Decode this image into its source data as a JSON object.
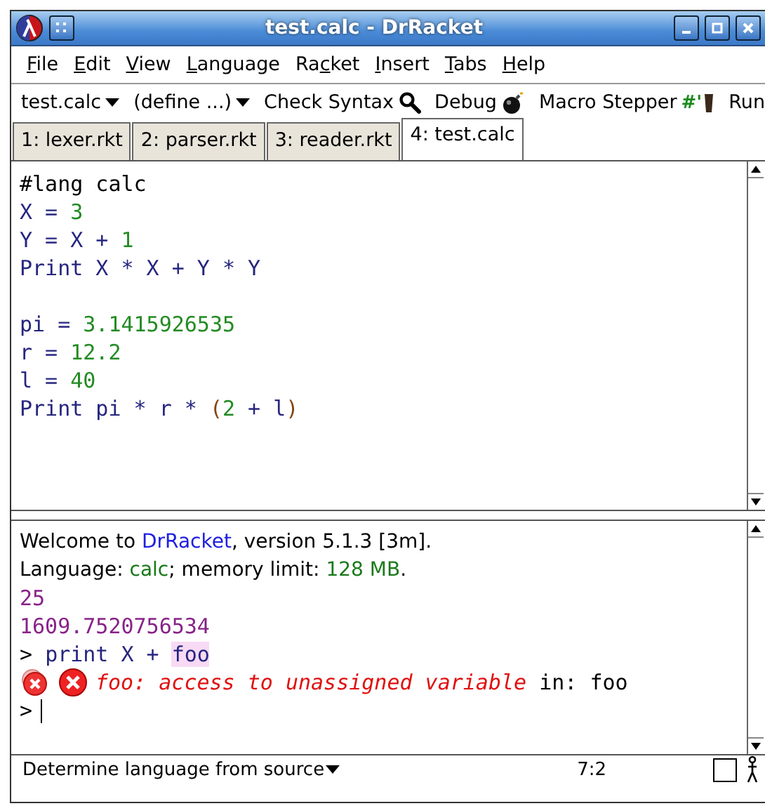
{
  "window": {
    "title": "test.calc - DrRacket"
  },
  "menu": [
    {
      "key": "F",
      "after": "ile"
    },
    {
      "key": "E",
      "after": "dit"
    },
    {
      "key": "V",
      "after": "iew"
    },
    {
      "key": "L",
      "after": "anguage"
    },
    {
      "before": "Ra",
      "key": "c",
      "after": "ket"
    },
    {
      "key": "I",
      "after": "nsert"
    },
    {
      "key": "T",
      "after": "abs"
    },
    {
      "key": "H",
      "after": "elp"
    }
  ],
  "toolbar": [
    {
      "kind": "dropdown",
      "label": "test.calc"
    },
    {
      "kind": "dropdown",
      "label": "(define ...)"
    },
    {
      "kind": "check",
      "label": "Check Syntax"
    },
    {
      "kind": "debug",
      "label": "Debug"
    },
    {
      "kind": "stepper",
      "label": "Macro Stepper",
      "icon_text": "#'"
    },
    {
      "kind": "run",
      "label": "Run"
    }
  ],
  "tabs": [
    {
      "label": "1: lexer.rkt",
      "selected": false
    },
    {
      "label": "2: parser.rkt",
      "selected": false
    },
    {
      "label": "3: reader.rkt",
      "selected": false
    },
    {
      "label": "4: test.calc",
      "selected": true
    }
  ],
  "editor": {
    "blocks": [
      [
        [
          {
            "t": "#lang calc",
            "color": "#000000"
          }
        ],
        [
          {
            "t": "X = ",
            "color": "#262680"
          },
          {
            "t": "3",
            "color": "#228b22"
          }
        ],
        [
          {
            "t": "Y = X + ",
            "color": "#262680"
          },
          {
            "t": "1",
            "color": "#228b22"
          }
        ],
        [
          {
            "t": "Print X * X + Y * Y",
            "color": "#262680"
          }
        ]
      ],
      [
        [
          {
            "t": "pi = ",
            "color": "#262680"
          },
          {
            "t": "3.1415926535",
            "color": "#228b22"
          }
        ],
        [
          {
            "t": "r = ",
            "color": "#262680"
          },
          {
            "t": "12.2",
            "color": "#228b22"
          }
        ],
        [
          {
            "t": "l = ",
            "color": "#262680"
          },
          {
            "t": "40",
            "color": "#228b22"
          }
        ],
        [
          {
            "t": "Print pi * r * ",
            "color": "#262680"
          },
          {
            "t": "(",
            "color": "#84450f"
          },
          {
            "t": "2",
            "color": "#228b22"
          },
          {
            "t": " + l",
            "color": "#262680"
          },
          {
            "t": ")",
            "color": "#84450f"
          }
        ]
      ]
    ]
  },
  "interactions": {
    "lines": [
      {
        "kind": "info",
        "segments": [
          {
            "t": "Welcome to ",
            "color": "#000000"
          },
          {
            "t": "DrRacket",
            "color": "#2020e0"
          },
          {
            "t": ", version 5.1.3 [3m].",
            "color": "#000000"
          }
        ]
      },
      {
        "kind": "info",
        "segments": [
          {
            "t": "Language: ",
            "color": "#000000"
          },
          {
            "t": "calc",
            "color": "#1a7a1a"
          },
          {
            "t": "; memory limit: ",
            "color": "#000000"
          },
          {
            "t": "128 MB",
            "color": "#1a7a1a"
          },
          {
            "t": ".",
            "color": "#000000"
          }
        ]
      },
      {
        "kind": "result",
        "segments": [
          {
            "t": "25",
            "color": "#882288"
          }
        ]
      },
      {
        "kind": "result",
        "segments": [
          {
            "t": "1609.7520756534",
            "color": "#882288"
          }
        ]
      },
      {
        "kind": "input",
        "segments": [
          {
            "t": "> ",
            "color": "#000000"
          },
          {
            "t": "print X + ",
            "color": "#262680"
          },
          {
            "t": "foo",
            "color": "#262680",
            "highlighted": true
          }
        ]
      },
      {
        "kind": "error",
        "segments": [
          {
            "t": "foo: access to unassigned variable",
            "color": "#e01010",
            "italic": true
          },
          {
            "t": " in: foo",
            "color": "#000000"
          }
        ]
      },
      {
        "kind": "prompt",
        "segments": [
          {
            "t": ">",
            "color": "#000000"
          }
        ]
      }
    ]
  },
  "status_bar": {
    "language": "Determine language from source",
    "position": "7:2"
  }
}
